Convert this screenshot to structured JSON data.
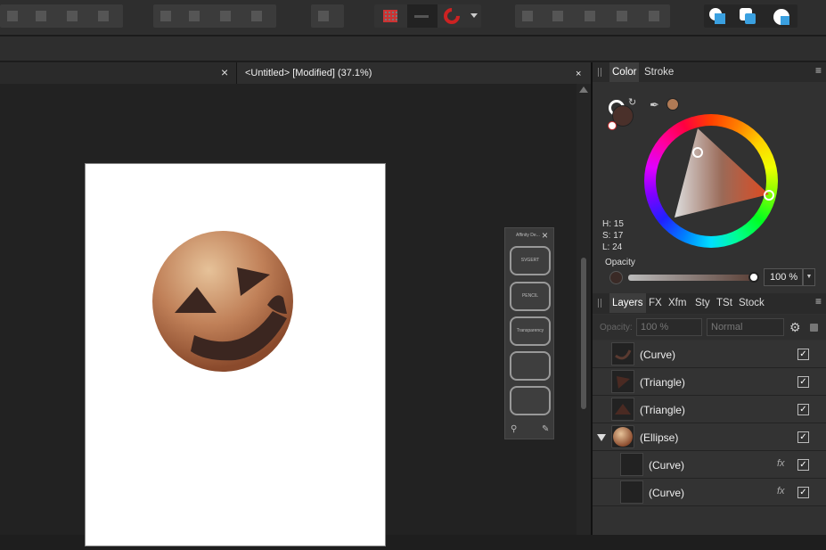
{
  "toolbar": {
    "icons": [
      "align-left-icon",
      "align-center-icon",
      "align-right-icon",
      "align-top-icon",
      "flip-icon",
      "arrange-icon",
      "order-icon",
      "grid-icon",
      "snap-bar-icon",
      "snapping-magnet-icon",
      "boolean-add-icon",
      "boolean-subtract-icon",
      "boolean-intersect-icon",
      "boolean-xor-icon",
      "boolean-divide-icon",
      "geometry-add-icon",
      "geometry-subtract-icon",
      "geometry-intersect-icon"
    ]
  },
  "document_tabs": {
    "active_title": "<Untitled> [Modified] (37.1%)",
    "close": "×"
  },
  "studio": {
    "title": "Affinity De...",
    "close": "×",
    "buttons": [
      "SVGERT",
      "PENCIL",
      "Transparency",
      "",
      ""
    ]
  },
  "color_panel": {
    "tabs": [
      "Color",
      "Stroke"
    ],
    "active_tab": "Color",
    "h": "H: 15",
    "s": "S: 17",
    "l": "L: 24",
    "opacity_label": "Opacity",
    "opacity_value": "100 %",
    "opacity_fraction": 1.0,
    "fill_color": "#5a3f36",
    "swatch_color": "#b07a55"
  },
  "layers_panel": {
    "tabs": [
      "Layers",
      "FX",
      "Xfm",
      "Sty",
      "TSt",
      "Stock"
    ],
    "active_tab": "Layers",
    "opacity_placeholder": "Opacity:",
    "opacity_value": "100 %",
    "blend_mode": "Normal",
    "rows": [
      {
        "label": "(Curve)",
        "fx": "",
        "checked": "✓"
      },
      {
        "label": "(Triangle)",
        "fx": "",
        "checked": "✓"
      },
      {
        "label": "(Triangle)",
        "fx": "",
        "checked": "✓"
      },
      {
        "label": "(Ellipse)",
        "fx": "",
        "checked": "✓"
      },
      {
        "label": "(Curve)",
        "fx": "fx",
        "checked": "✓"
      },
      {
        "label": "(Curve)",
        "fx": "fx",
        "checked": "✓"
      }
    ]
  }
}
